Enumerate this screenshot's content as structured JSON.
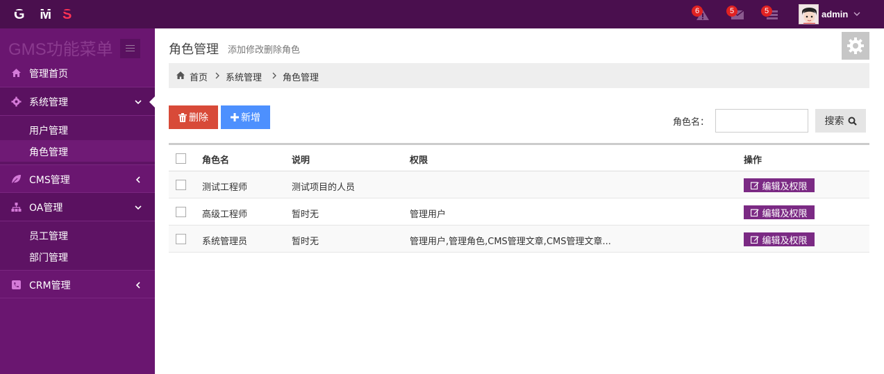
{
  "brand": {
    "logo_text": "GMS"
  },
  "topbar": {
    "alerts_count": "6",
    "messages_count": "5",
    "tasks_count": "5",
    "username": "admin"
  },
  "sidebar": {
    "title": "GMS功能菜单",
    "items": [
      {
        "label": "管理首页",
        "icon": "home-icon"
      },
      {
        "label": "系统管理",
        "icon": "gear-icon",
        "expanded": true,
        "children": [
          {
            "label": "用户管理"
          },
          {
            "label": "角色管理",
            "selected": true
          }
        ]
      },
      {
        "label": "CMS管理",
        "icon": "leaf-icon"
      },
      {
        "label": "OA管理",
        "icon": "sitemap-icon",
        "expanded": true,
        "children": [
          {
            "label": "员工管理"
          },
          {
            "label": "部门管理"
          }
        ]
      },
      {
        "label": "CRM管理",
        "icon": "phone-icon"
      }
    ]
  },
  "page": {
    "title": "角色管理",
    "subtitle": "添加修改删除角色",
    "breadcrumb": [
      "首页",
      "系统管理",
      "角色管理"
    ]
  },
  "toolbar": {
    "delete_label": "删除",
    "add_label": "新增",
    "search_label": "角色名：",
    "search_value": "",
    "search_button": "搜索"
  },
  "table": {
    "headers": [
      "角色名",
      "说明",
      "权限",
      "操作"
    ],
    "rows": [
      {
        "name": "测试工程师",
        "desc": "测试项目的人员",
        "perm": "",
        "action": "编辑及权限"
      },
      {
        "name": "高级工程师",
        "desc": "暂时无",
        "perm": "管理用户",
        "action": "编辑及权限"
      },
      {
        "name": "系统管理员",
        "desc": "暂时无",
        "perm": "管理用户,管理角色,CMS管理文章,CMS管理文章...",
        "action": "编辑及权限"
      }
    ]
  },
  "colors": {
    "topbar": "#4a0f4e",
    "sidebar": "#6a1670",
    "delete": "#d84a38",
    "add": "#4d90fe",
    "edit": "#7b2a84",
    "badge": "#e02222"
  }
}
